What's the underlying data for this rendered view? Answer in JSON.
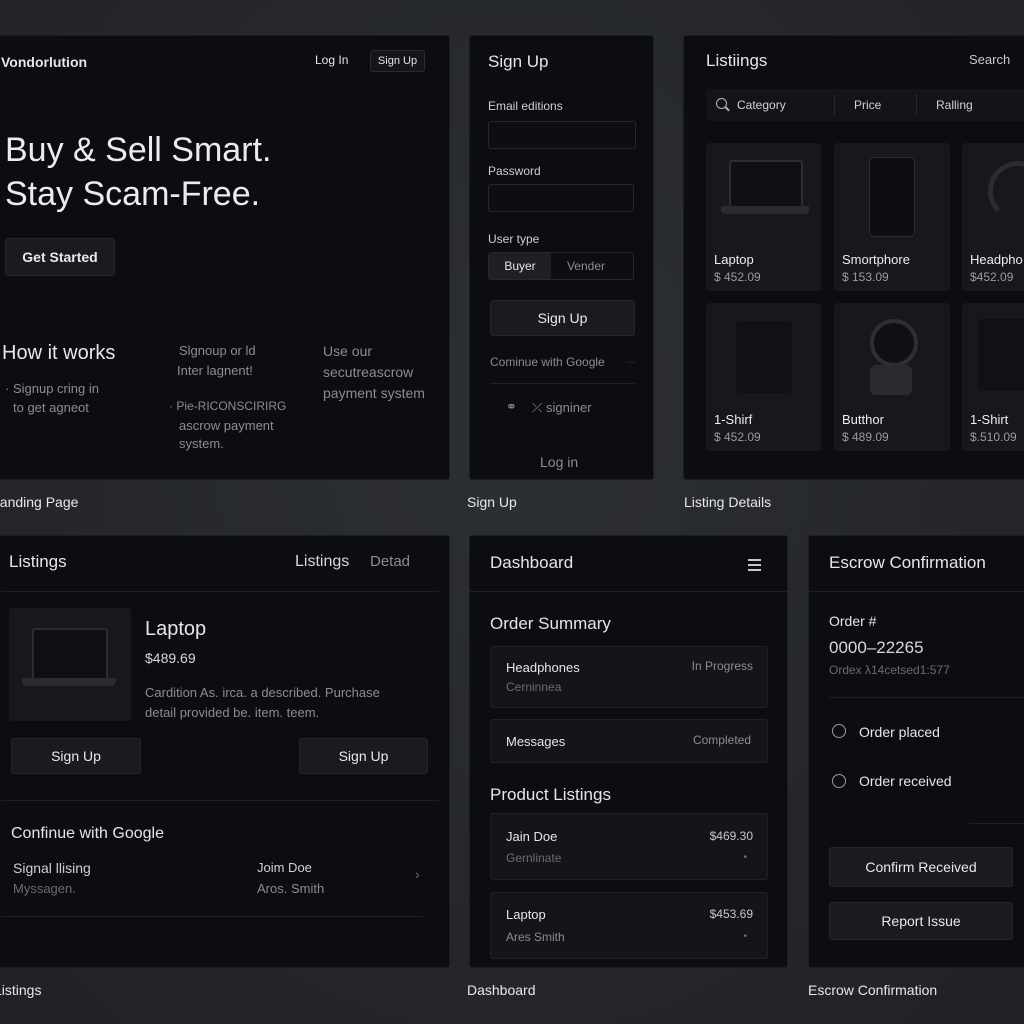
{
  "landing": {
    "brand": "Vondorlution",
    "login": "Log In",
    "signup": "Sign Up",
    "hero_line1": "Buy & Sell Smart.",
    "hero_line2": "Stay Scam-Free.",
    "cta": "Get Started",
    "how_title": "How it works",
    "how_col1_line1": "· Signup cring in",
    "how_col1_line2": "to get agneot",
    "how_col2_line1": "Slgnoup or ld",
    "how_col2_line2": "Inter lagnent!",
    "how_col2_b1": "· Pie-RICONSCIRIRG",
    "how_col2_b2": "ascrow payment",
    "how_col2_b3": "system.",
    "how_col3_line1": "Use our",
    "how_col3_line2": "secutreascrow",
    "how_col3_line3": "payment system",
    "caption": "Landing Page"
  },
  "signup": {
    "title": "Sign Up",
    "email_label": "Email editions",
    "password_label": "Password",
    "user_type_label": "User type",
    "buyer": "Buyer",
    "vendor": "Vender",
    "submit": "Sign Up",
    "google": "Cominue with Google",
    "alt_signin": "signiner",
    "login": "Log in",
    "caption": "Sign Up"
  },
  "listing_details": {
    "title": "Listiings",
    "search": "Search",
    "filters": [
      "Category",
      "Price",
      "Ralling"
    ],
    "cards": [
      {
        "name": "Laptop",
        "price": "$ 452.09"
      },
      {
        "name": "Smortphore",
        "price": "$ 153.09"
      },
      {
        "name": "Headpho",
        "price": "$452.09"
      },
      {
        "name": "1-Shirf",
        "price": "$ 452.09"
      },
      {
        "name": "Butthor",
        "price": "$ 489.09"
      },
      {
        "name": "1-Shirt",
        "price": "$.510.09"
      }
    ],
    "caption": "Listing Details"
  },
  "listings": {
    "title": "Listings",
    "tab1": "Listings",
    "tab2": "Detad",
    "product_name": "Laptop",
    "product_price": "$489.69",
    "desc_line1": "Cardition As. irca. a described. Purchase",
    "desc_line2": "detail provided be. item. teem.",
    "btn1": "Sign Up",
    "btn2": "Sign Up",
    "google": "Confinue with Google",
    "row1_left_title": "Signal llising",
    "row1_left_sub": "Myssagen.",
    "row1_right_title": "Joim Doe",
    "row1_right_sub": "Aros. Smith",
    "caption": "Listings"
  },
  "dashboard": {
    "title": "Dashboard",
    "order_summary": "Order Summary",
    "orders": [
      {
        "title": "Headphones",
        "sub": "Cerninnea",
        "status": "In Progress"
      },
      {
        "title": "Messages",
        "sub": "",
        "status": "Completed"
      }
    ],
    "product_listings": "Product Listings",
    "products": [
      {
        "title": "Jain Doe",
        "sub": "Gernlinate",
        "price": "$469.30"
      },
      {
        "title": "Laptop",
        "sub": "Ares Smith",
        "price": "$453.69"
      }
    ],
    "caption": "Dashboard"
  },
  "escrow": {
    "title": "Escrow Confirmation",
    "order_label": "Order #",
    "order_number": "0000–22265",
    "order_sub": "Ordex λ14cetsed1:577",
    "step1": "Order placed",
    "step2": "Order received",
    "confirm": "Confirm Received",
    "report": "Report Issue",
    "caption": "Escrow Confirmation"
  },
  "colors": {
    "background": "#25272b",
    "panel": "#0c0d10",
    "button": "#1a1b1f",
    "text": "#e6e6e8",
    "muted": "#8b8d93"
  }
}
